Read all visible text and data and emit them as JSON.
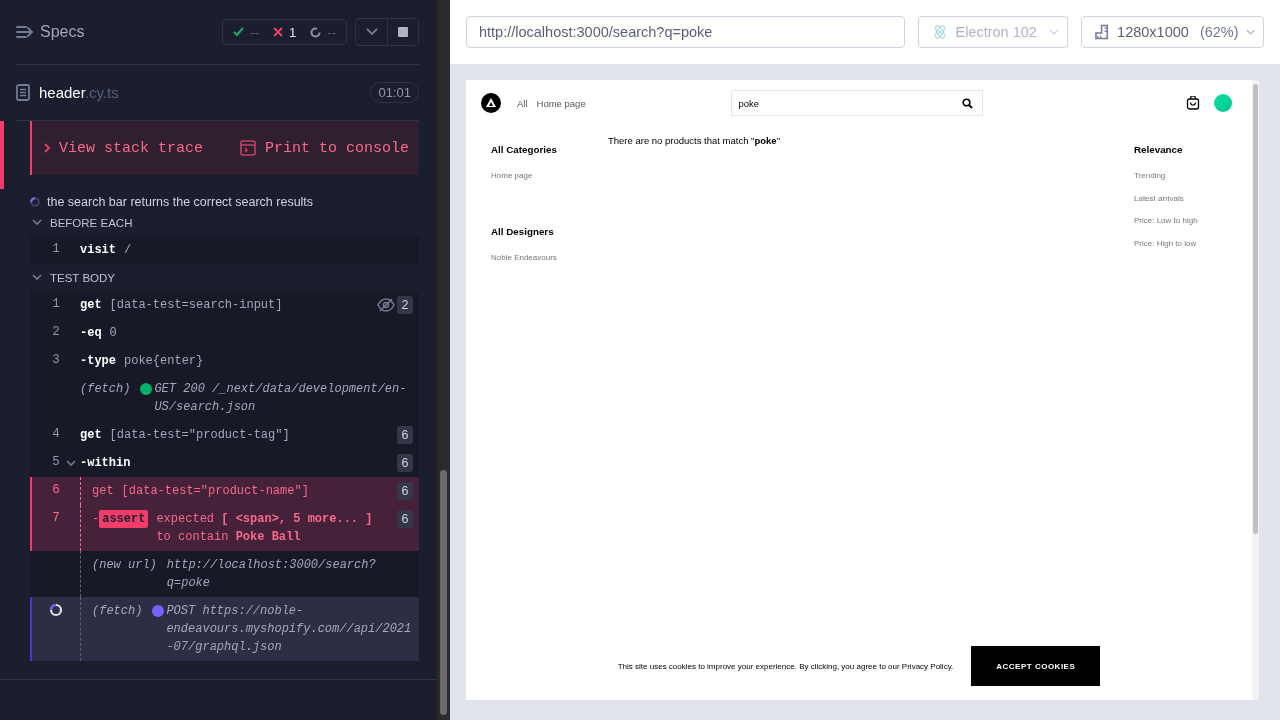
{
  "reporter": {
    "title": "Specs",
    "stats": [
      {
        "kind": "passed",
        "value": "--"
      },
      {
        "kind": "failed",
        "value": "1"
      },
      {
        "kind": "pending",
        "value": "--"
      }
    ],
    "spec": {
      "file": "header",
      "extension": ".cy.ts",
      "duration": "01:01"
    },
    "error_actions": [
      {
        "kind": "stack",
        "label": "View stack trace"
      },
      {
        "kind": "console",
        "label": "Print to console"
      }
    ],
    "test": {
      "title": "the search bar returns the correct search results",
      "running": true
    },
    "hooks": [
      {
        "title": "BEFORE EACH",
        "expanded": true,
        "commands": [
          {
            "kind": "command",
            "number": "1",
            "name": "visit",
            "message": "/",
            "failed": false,
            "running": false
          }
        ]
      },
      {
        "title": "TEST BODY",
        "expanded": true,
        "commands": [
          {
            "kind": "command",
            "number": "1",
            "name": "get",
            "message": "[data-test=search-input]",
            "badge": "2",
            "hidden": true,
            "failed": false,
            "running": false
          },
          {
            "kind": "child",
            "number": "2",
            "prefix": "-",
            "name": "eq",
            "message": "0",
            "failed": false,
            "running": false
          },
          {
            "kind": "child",
            "number": "3",
            "prefix": "-",
            "name": "type",
            "message": "poke{enter}",
            "failed": false,
            "running": false
          },
          {
            "kind": "event",
            "name": "(fetch)",
            "color": "#00b26a",
            "message": "GET 200 /_next/data/development/en-US/search.json",
            "failed": false,
            "running": false
          },
          {
            "kind": "command",
            "number": "4",
            "name": "get",
            "message": "[data-test=\"product-tag\"]",
            "badge": "6",
            "failed": false,
            "running": false
          },
          {
            "kind": "child",
            "number": "5",
            "prefix": "-",
            "name": "within",
            "badge": "6",
            "expanded": true,
            "failed": false,
            "running": false,
            "children": [
              {
                "kind": "command",
                "number": "6",
                "name": "get",
                "message": "[data-test=\"product-name\"]",
                "badge": "6",
                "failed": true,
                "running": false
              },
              {
                "kind": "assert",
                "number": "7",
                "prefix": "-",
                "name": "assert",
                "message": "expected **[ <span>, 5 more... ]** to contain **Poke Ball**",
                "badge": "6",
                "failed": true,
                "running": false
              },
              {
                "kind": "event",
                "name": "(new url)",
                "message": "http://localhost:3000/search?q=poke",
                "failed": false,
                "running": false
              },
              {
                "kind": "event",
                "name": "(fetch)",
                "color": "#7565f7",
                "message": "POST https://noble-endeavours.myshopify.com//api/2021-07/graphql.json",
                "failed": false,
                "running": true
              }
            ]
          }
        ]
      }
    ]
  },
  "browser": {
    "url": "http://localhost:3000/search?q=poke",
    "engine": "Electron 102",
    "viewport": "1280x1000",
    "scale": "(62%)"
  },
  "app": {
    "nav": [
      "All",
      "Home page"
    ],
    "search": {
      "value": "poke"
    },
    "message": "There are no products that match \"**poke**\"",
    "filters": [
      {
        "title": "All Categories",
        "items": [
          "Home page"
        ]
      },
      {
        "title": "All Designers",
        "items": [
          "Noble Endeavours"
        ]
      }
    ],
    "sort": {
      "title": "Relevance",
      "items": [
        "Trending",
        "Latest arrivals",
        "Price: Low to high",
        "Price: High to low"
      ]
    },
    "cookie": {
      "text": "This site uses cookies to improve your experience. By clicking, you agree to our Privacy Policy.",
      "button": "ACCEPT COOKIES"
    }
  }
}
